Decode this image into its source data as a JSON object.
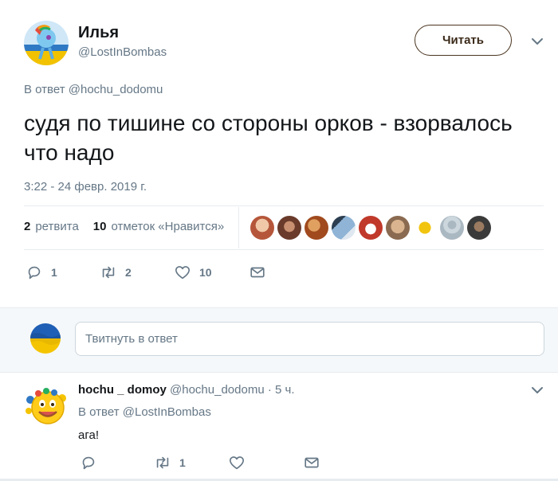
{
  "tweet": {
    "author_name": "Илья",
    "author_handle": "@LostInBombas",
    "follow_label": "Читать",
    "reply_to_prefix": "В ответ",
    "reply_to_user": "@hochu_dodomu",
    "text": "судя по тишине со стороны орков - взорвалось что надо",
    "timestamp": "3:22 - 24 февр. 2019 г.",
    "retweets_count": "2",
    "retweets_label": "ретвита",
    "likes_count": "10",
    "likes_label": "отметок «Нравится»",
    "actions": {
      "replies": "1",
      "retweets": "2",
      "likes": "10"
    }
  },
  "reply_box": {
    "placeholder": "Твитнуть в ответ"
  },
  "reply": {
    "author_name": "hochu _ domoy",
    "author_handle": "@hochu_dodomu",
    "age": "5 ч.",
    "reply_to_prefix": "В ответ",
    "reply_to_user": "@LostInBombas",
    "text": "ага!",
    "actions": {
      "replies": "",
      "retweets": "1",
      "likes": ""
    }
  },
  "likers": [
    {
      "icon": "liker-avatar",
      "color": "#b5563a"
    },
    {
      "icon": "liker-avatar",
      "color": "#6a3a2a"
    },
    {
      "icon": "liker-avatar",
      "color": "#a04a1e"
    },
    {
      "icon": "liker-avatar",
      "color": "#8fb4d6"
    },
    {
      "icon": "liker-avatar",
      "color": "#c0392b"
    },
    {
      "icon": "liker-avatar",
      "color": "#d9b48f"
    },
    {
      "icon": "liker-avatar",
      "color": "#f1c40f"
    },
    {
      "icon": "liker-avatar",
      "color": "#aab8c2"
    },
    {
      "icon": "liker-avatar",
      "color": "#3a3a3a"
    }
  ],
  "colors": {
    "accent": "#1da1f2",
    "muted": "#657786",
    "divider": "#e6ecf0",
    "follow_border": "#4a3520"
  }
}
